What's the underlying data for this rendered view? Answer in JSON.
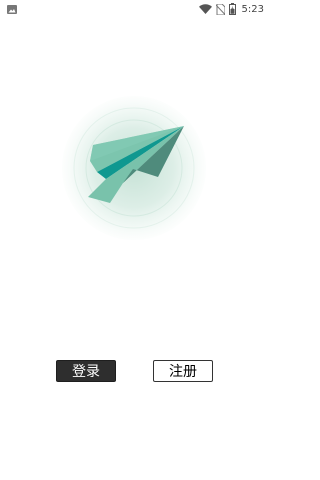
{
  "status_bar": {
    "time": "5:23",
    "icons": [
      "image-icon",
      "wifi-icon",
      "no-sim-icon",
      "battery-icon"
    ]
  },
  "logo": {
    "icon": "paper-plane-icon",
    "colors": {
      "plane_light": "#79c2ab",
      "plane_mid": "#5fae97",
      "plane_teal": "#0f9890",
      "plane_dark": "#4f8b7c",
      "halo": "#cfe7dd"
    }
  },
  "buttons": {
    "login_label": "登录",
    "register_label": "注册"
  }
}
